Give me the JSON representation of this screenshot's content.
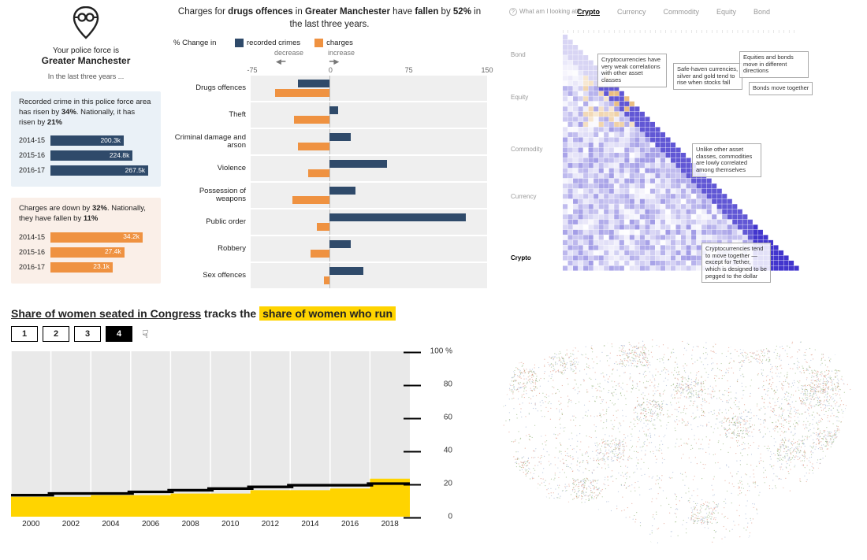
{
  "chart_data": [
    {
      "id": "manchester_recorded",
      "type": "bar",
      "title": "Recorded crime in this police force area has risen by 34%. Nationally, it has risen by 21%",
      "categories": [
        "2014-15",
        "2015-16",
        "2016-17"
      ],
      "values_label": [
        "200.3k",
        "224.8k",
        "267.5k"
      ],
      "values": [
        200.3,
        224.8,
        267.5
      ],
      "color": "#2f4a6a"
    },
    {
      "id": "manchester_charges",
      "type": "bar",
      "title": "Charges are down by 32%. Nationally, they have fallen by 11%",
      "categories": [
        "2014-15",
        "2015-16",
        "2016-17"
      ],
      "values_label": [
        "34.2k",
        "27.4k",
        "23.1k"
      ],
      "values": [
        34.2,
        27.4,
        23.1
      ],
      "color": "#ef9241"
    },
    {
      "id": "manchester_change",
      "type": "bar",
      "title": "Charges for drugs offences in Greater Manchester have fallen by 52% in the last three years.",
      "legend_label": "% Change in",
      "series_legend": [
        "recorded crimes",
        "charges"
      ],
      "xlabel": "",
      "axis_labels": {
        "decrease": "decrease",
        "increase": "increase"
      },
      "xlim": [
        -75,
        150
      ],
      "xticks": [
        -75,
        0,
        75,
        150
      ],
      "categories": [
        "Drugs offences",
        "Theft",
        "Criminal damage and arson",
        "Violence",
        "Possession of weapons",
        "Public order",
        "Robbery",
        "Sex offences"
      ],
      "series": [
        {
          "name": "recorded crimes",
          "color": "#2f4a6a",
          "values": [
            -30,
            8,
            20,
            55,
            25,
            130,
            20,
            32
          ]
        },
        {
          "name": "charges",
          "color": "#ef9241",
          "values": [
            -52,
            -34,
            -30,
            -20,
            -35,
            -12,
            -18,
            -5
          ]
        }
      ]
    },
    {
      "id": "congress_women",
      "type": "area",
      "title": "Share of women seated in Congress tracks the share of women who run",
      "highlight_text": "share of women who run",
      "underline_text": "Share of women seated in Congress",
      "connector": " tracks the  ",
      "ylim": [
        0,
        100
      ],
      "ylabel_suffix": "%",
      "yticks": [
        0,
        20,
        40,
        60,
        80,
        100
      ],
      "x": [
        2000,
        2002,
        2004,
        2006,
        2008,
        2010,
        2012,
        2014,
        2016,
        2018
      ],
      "series": [
        {
          "name": "share who run",
          "color": "#ffd400",
          "values": [
            12,
            12,
            13,
            13,
            14,
            14,
            16,
            16,
            17,
            23
          ]
        },
        {
          "name": "share seated",
          "color": "#000000",
          "values": [
            13,
            14,
            14,
            15,
            16,
            17,
            18,
            19,
            19,
            20
          ]
        }
      ],
      "step_buttons": [
        "1",
        "2",
        "3",
        "4"
      ],
      "active_step": "4"
    },
    {
      "id": "correlation_heatmap",
      "type": "heatmap",
      "tabs": [
        "Crypto",
        "Currency",
        "Commodity",
        "Equity",
        "Bond"
      ],
      "active_tab": "Crypto",
      "hint": "What am I looking at?",
      "note": "Lower-triangular asset-pair correlation matrix; individual cell values not legible at this resolution.",
      "color_scale": {
        "low": "#ffffff",
        "mid": "#f3d9a6",
        "high": "#3b3bd1"
      },
      "y_axis_groups": [
        "Bond",
        "Equity",
        "Commodity",
        "Currency",
        "Crypto"
      ],
      "annotations": [
        {
          "text": "Cryptocurrencies have very weak correlations with other asset classes",
          "x": 0.18,
          "y": 0.1
        },
        {
          "text": "Safe-haven currencies, silver and gold tend to rise when stocks fall",
          "x": 0.5,
          "y": 0.14
        },
        {
          "text": "Equities and bonds move in different directions",
          "x": 0.78,
          "y": 0.09
        },
        {
          "text": "Bonds move together",
          "x": 0.82,
          "y": 0.22
        },
        {
          "text": "Unlike other asset classes, commodities are lowly correlated among themselves",
          "x": 0.58,
          "y": 0.48
        },
        {
          "text": "Cryptocurrencies tend to move together — except for Tether, which is designed to be pegged to the dollar",
          "x": 0.62,
          "y": 0.9
        }
      ]
    },
    {
      "id": "us_dot_map",
      "type": "scatter",
      "title": "",
      "note": "Dot-density map of the contiguous United States; individual points not enumerable.",
      "palette": {
        "a": "#d97b63",
        "b": "#7aa35a",
        "c": "#8aa0c9"
      }
    }
  ],
  "tl": {
    "force_label": "Your police force is",
    "force_name": "Greater Manchester",
    "subtext": "In the last three years ..."
  }
}
